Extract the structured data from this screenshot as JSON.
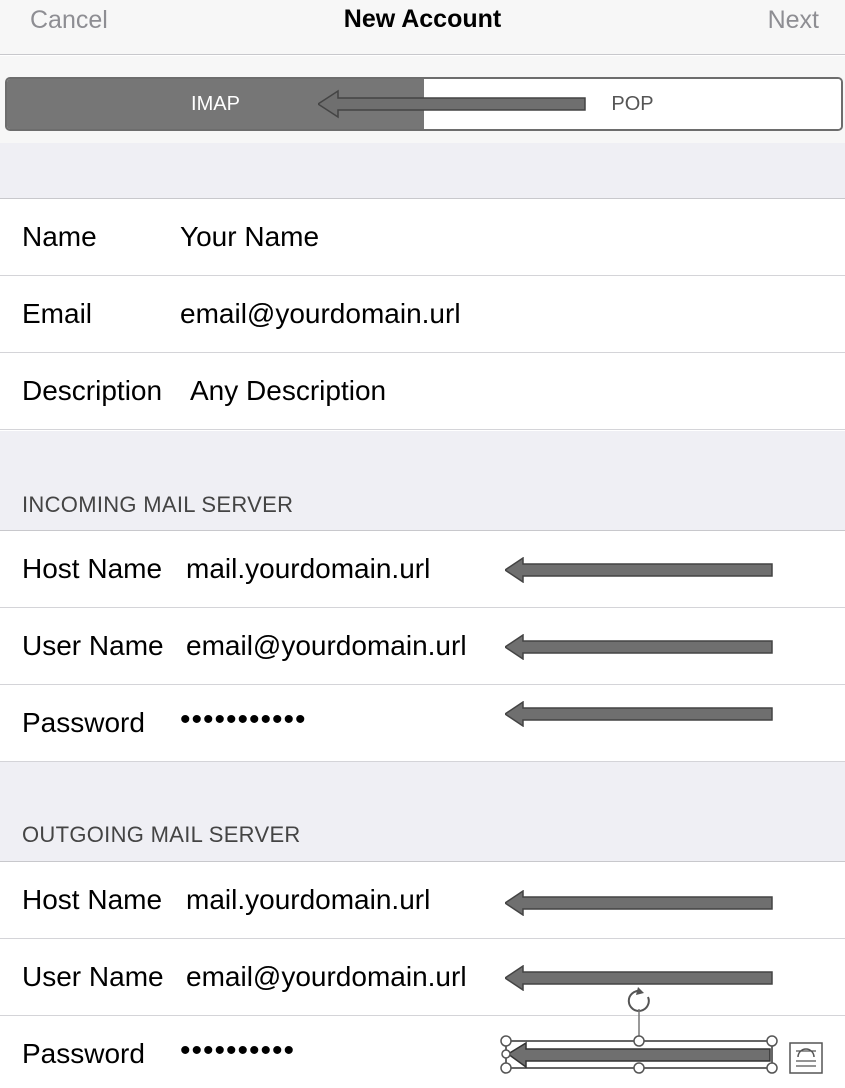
{
  "nav": {
    "cancel_label": "Cancel",
    "title": "New Account",
    "next_label": "Next"
  },
  "segmented": {
    "options": [
      "IMAP",
      "POP"
    ],
    "selected": "IMAP"
  },
  "account": {
    "name_label": "Name",
    "name_value": "Your Name",
    "email_label": "Email",
    "email_value": "email@yourdomain.url",
    "description_label": "Description",
    "description_value": "Any Description"
  },
  "incoming": {
    "header": "INCOMING MAIL SERVER",
    "host_label": "Host Name",
    "host_value": "mail.yourdomain.url",
    "user_label": "User Name",
    "user_value": "email@yourdomain.url",
    "password_label": "Password",
    "password_value": "•••••••••••"
  },
  "outgoing": {
    "header": "OUTGOING MAIL SERVER",
    "host_label": "Host Name",
    "host_value": "mail.yourdomain.url",
    "user_label": "User Name",
    "user_value": "email@yourdomain.url",
    "password_label": "Password",
    "password_value": "••••••••••"
  },
  "colors": {
    "segment_selected": "#767676",
    "arrow_fill": "#6f6f6f",
    "nav_button": "#8e8e93"
  }
}
